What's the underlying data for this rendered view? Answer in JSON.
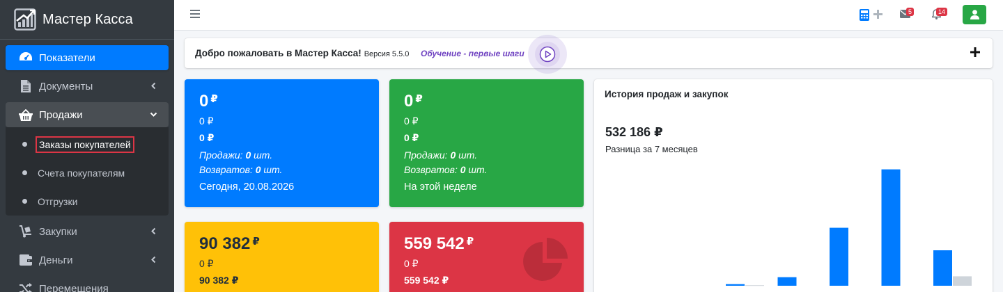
{
  "sidebar": {
    "brand": "Мастер Касса",
    "items": [
      {
        "label": "Показатели",
        "icon": "dashboard-gauge-icon"
      },
      {
        "label": "Документы",
        "icon": "document-icon"
      },
      {
        "label": "Продажи",
        "icon": "basket-icon"
      },
      {
        "label": "Закупки",
        "icon": "dolly-icon"
      },
      {
        "label": "Деньги",
        "icon": "wallet-icon"
      },
      {
        "label": "Перемещения",
        "icon": "shuffle-icon"
      }
    ],
    "sales_sub": [
      {
        "label": "Заказы покупателей"
      },
      {
        "label": "Счета покупателям"
      },
      {
        "label": "Отгрузки"
      }
    ]
  },
  "topbar": {
    "mail_count": "5",
    "notifications_count": "14"
  },
  "welcome": {
    "title": "Добро пожаловать в Мастер Касса!",
    "version": "Версия 5.5.0",
    "tutorial_prefix": "Обучение - ",
    "tutorial_link": "первые шаги"
  },
  "stats": {
    "today": {
      "total": "0",
      "currency": "₽",
      "line1": "0 ₽",
      "line2": "0  ₽",
      "sales_label": "Продажи:",
      "sales_value": "0",
      "unit": "шт.",
      "returns_label": "Возвратов:",
      "returns_value": "0",
      "period": "Сегодня, 20.08.2026"
    },
    "week": {
      "total": "0",
      "currency": "₽",
      "line1": "0 ₽",
      "line2": "0  ₽",
      "sales_label": "Продажи:",
      "sales_value": "0",
      "unit": "шт.",
      "returns_label": "Возвратов:",
      "returns_value": "0",
      "period": "На этой неделе"
    },
    "month": {
      "total": "90 382",
      "currency": "₽",
      "line1": "0 ₽",
      "line2": "90 382  ₽"
    },
    "year": {
      "total": "559 542",
      "currency": "₽",
      "line1": "0 ₽",
      "line2": "559 542  ₽"
    }
  },
  "chart_data": {
    "type": "bar",
    "title": "История продаж и закупок",
    "total": "532 186 ₽",
    "subtitle": "Разница за 7 месяцев",
    "grid": false,
    "ylim": [
      0,
      260000
    ],
    "series": [
      {
        "values": [
          0,
          0,
          3500,
          19000,
          129000,
          259000,
          79000
        ]
      },
      {
        "values": [
          0,
          0,
          1200,
          0,
          0,
          0,
          21000
        ]
      }
    ],
    "colors": [
      "#007bff",
      "#ced4da"
    ]
  }
}
